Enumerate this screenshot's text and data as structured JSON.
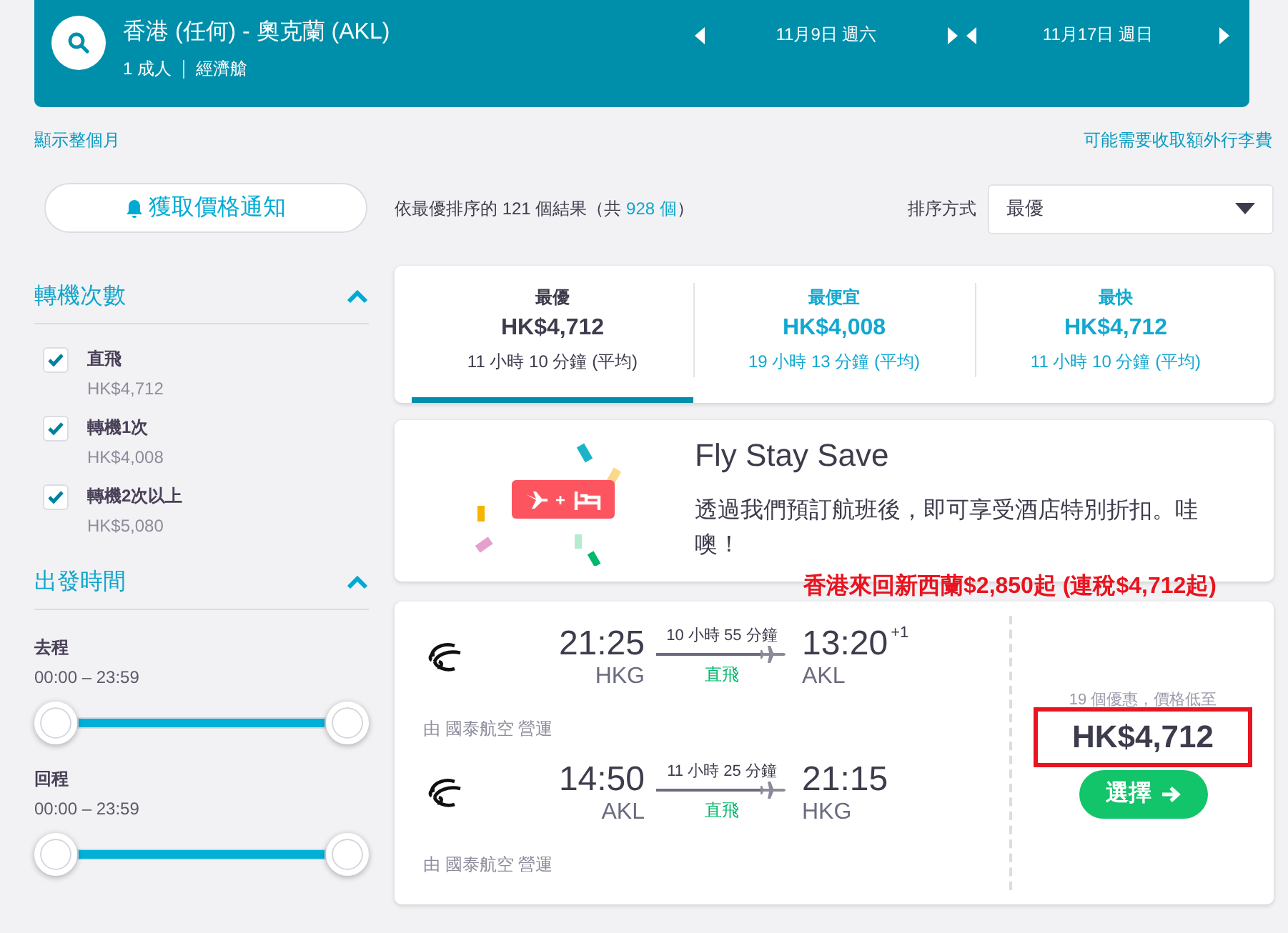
{
  "header": {
    "route": "香港 (任何) - 奧克蘭 (AKL)",
    "passengers": "1 成人",
    "cabin": "經濟艙",
    "out_date": "11月9日 週六",
    "return_date": "11月17日 週日"
  },
  "links": {
    "show_month": "顯示整個月",
    "baggage_note": "可能需要收取額外行李費"
  },
  "price_alert": "獲取價格通知",
  "summary": {
    "prefix": "依最優排序的 121 個結果（共 ",
    "total": "928 個",
    "suffix": "）"
  },
  "sort": {
    "label": "排序方式",
    "value": "最優"
  },
  "stops_filter": {
    "title": "轉機次數",
    "expanded": true,
    "options": [
      {
        "label": "直飛",
        "price": "HK$4,712",
        "checked": true
      },
      {
        "label": "轉機1次",
        "price": "HK$4,008",
        "checked": true
      },
      {
        "label": "轉機2次以上",
        "price": "HK$5,080",
        "checked": true
      }
    ]
  },
  "time_filter": {
    "title": "出發時間",
    "expanded": true,
    "ranges": [
      {
        "label": "去程",
        "range": "00:00 – 23:59",
        "level": 1
      },
      {
        "label": "回程",
        "range": "00:00 – 23:59",
        "level": 1
      }
    ]
  },
  "tabs": [
    {
      "title": "最優",
      "price": "HK$4,712",
      "duration": "11 小時 10 分鐘 (平均)",
      "selected": true
    },
    {
      "title": "最便宜",
      "price": "HK$4,008",
      "duration": "19 小時 13 分鐘 (平均)",
      "selected": false
    },
    {
      "title": "最快",
      "price": "HK$4,712",
      "duration": "11 小時 10 分鐘 (平均)",
      "selected": false
    }
  ],
  "promo": {
    "title": "Fly Stay Save",
    "text": "透過我們預訂航班後，即可享受酒店特別折扣。哇噢！",
    "badge_plus": "+"
  },
  "annotation": "香港來回新西蘭$2,850起 (連稅$4,712起)",
  "flight": {
    "legs": [
      {
        "dep_time": "21:25",
        "dep_airport": "HKG",
        "duration": "10 小時 55 分鐘",
        "stops": "直飛",
        "arr_time": "13:20",
        "day_offset": "+1",
        "arr_airport": "AKL",
        "operator": "由 國泰航空 營運"
      },
      {
        "dep_time": "14:50",
        "dep_airport": "AKL",
        "duration": "11 小時 25 分鐘",
        "stops": "直飛",
        "arr_time": "21:15",
        "arr_airport": "HKG",
        "operator": "由 國泰航空 營運"
      }
    ],
    "deals": "19 個優惠，價格低至",
    "price": "HK$4,712",
    "select": "選擇"
  }
}
